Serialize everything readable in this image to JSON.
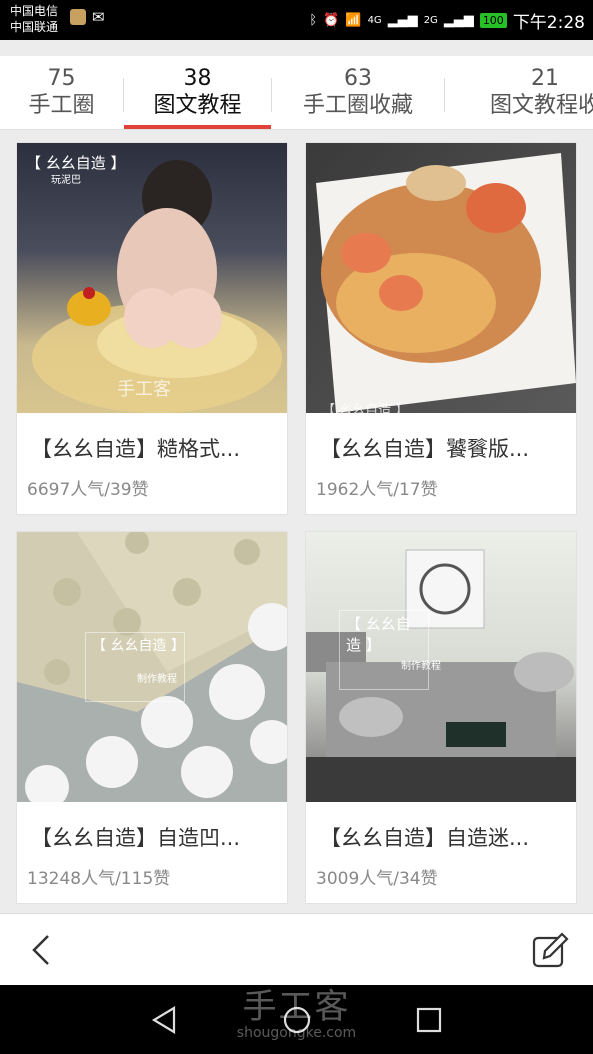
{
  "status_bar": {
    "carrier1": "中国电信",
    "carrier2": "中国联通",
    "network1": "4G",
    "network2": "2G",
    "battery": "100",
    "time": "下午2:28"
  },
  "tabs": [
    {
      "count": "75",
      "label": "手工圈"
    },
    {
      "count": "38",
      "label": "图文教程"
    },
    {
      "count": "63",
      "label": "手工圈收藏"
    },
    {
      "count": "21",
      "label": "图文教程收"
    }
  ],
  "cards": [
    {
      "title": "【幺幺自造】糙格式...",
      "stats": "6697人气/39赞",
      "watermark": "【 幺幺自造 】",
      "watermark_sub": "玩泥巴",
      "site": "手工客"
    },
    {
      "title": "【幺幺自造】饕餮版...",
      "stats": "1962人气/17赞",
      "watermark": "【 幺幺自造 】"
    },
    {
      "title": "【幺幺自造】自造凹...",
      "stats": "13248人气/115赞",
      "watermark": "【 幺幺自造 】",
      "watermark_sub": "制作教程"
    },
    {
      "title": "【幺幺自造】自造迷...",
      "stats": "3009人气/34赞",
      "watermark": "【 幺幺自造 】",
      "watermark_sub": "制作教程"
    }
  ],
  "bottom_watermark": {
    "brand": "手工客",
    "url": "shougongke.com"
  },
  "icons": [
    "back-icon",
    "edit-icon",
    "nav-back-icon",
    "nav-home-icon",
    "nav-recent-icon"
  ]
}
